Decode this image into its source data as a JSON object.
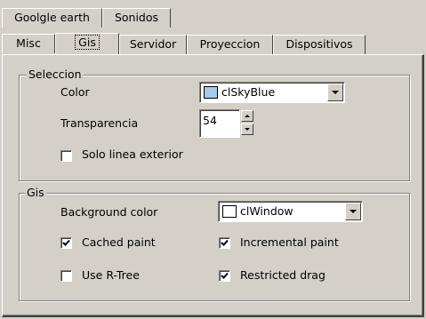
{
  "tabs": {
    "row1": [
      "Goolgle earth",
      "Sonidos"
    ],
    "row2": [
      "Misc",
      "Gis",
      "Servidor",
      "Proyeccion",
      "Dispositivos"
    ],
    "selected": "Gis"
  },
  "seleccion": {
    "title": "Seleccion",
    "color_label": "Color",
    "color_value": "clSkyBlue",
    "color_swatch": "#a6caf0",
    "transparency_label": "Transparencia",
    "transparency_value": "54",
    "outline_label": "Solo linea exterior",
    "outline_checked": false
  },
  "gis": {
    "title": "Gis",
    "bg_label": "Background color",
    "bg_value": "clWindow",
    "bg_swatch": "#ffffff",
    "cached_label": "Cached paint",
    "cached_checked": true,
    "incremental_label": "Incremental paint",
    "incremental_checked": true,
    "rtree_label": "Use R-Tree",
    "rtree_checked": false,
    "restricted_label": "Restricted drag",
    "restricted_checked": true
  },
  "icons": {
    "dropdown": "chevron-down-icon",
    "spin_up": "arrow-up-icon",
    "spin_down": "arrow-down-icon",
    "check": "checkmark-icon"
  },
  "colors": {
    "face": "#d4d0c8",
    "shadow": "#808080",
    "highlight": "#ffffff"
  }
}
